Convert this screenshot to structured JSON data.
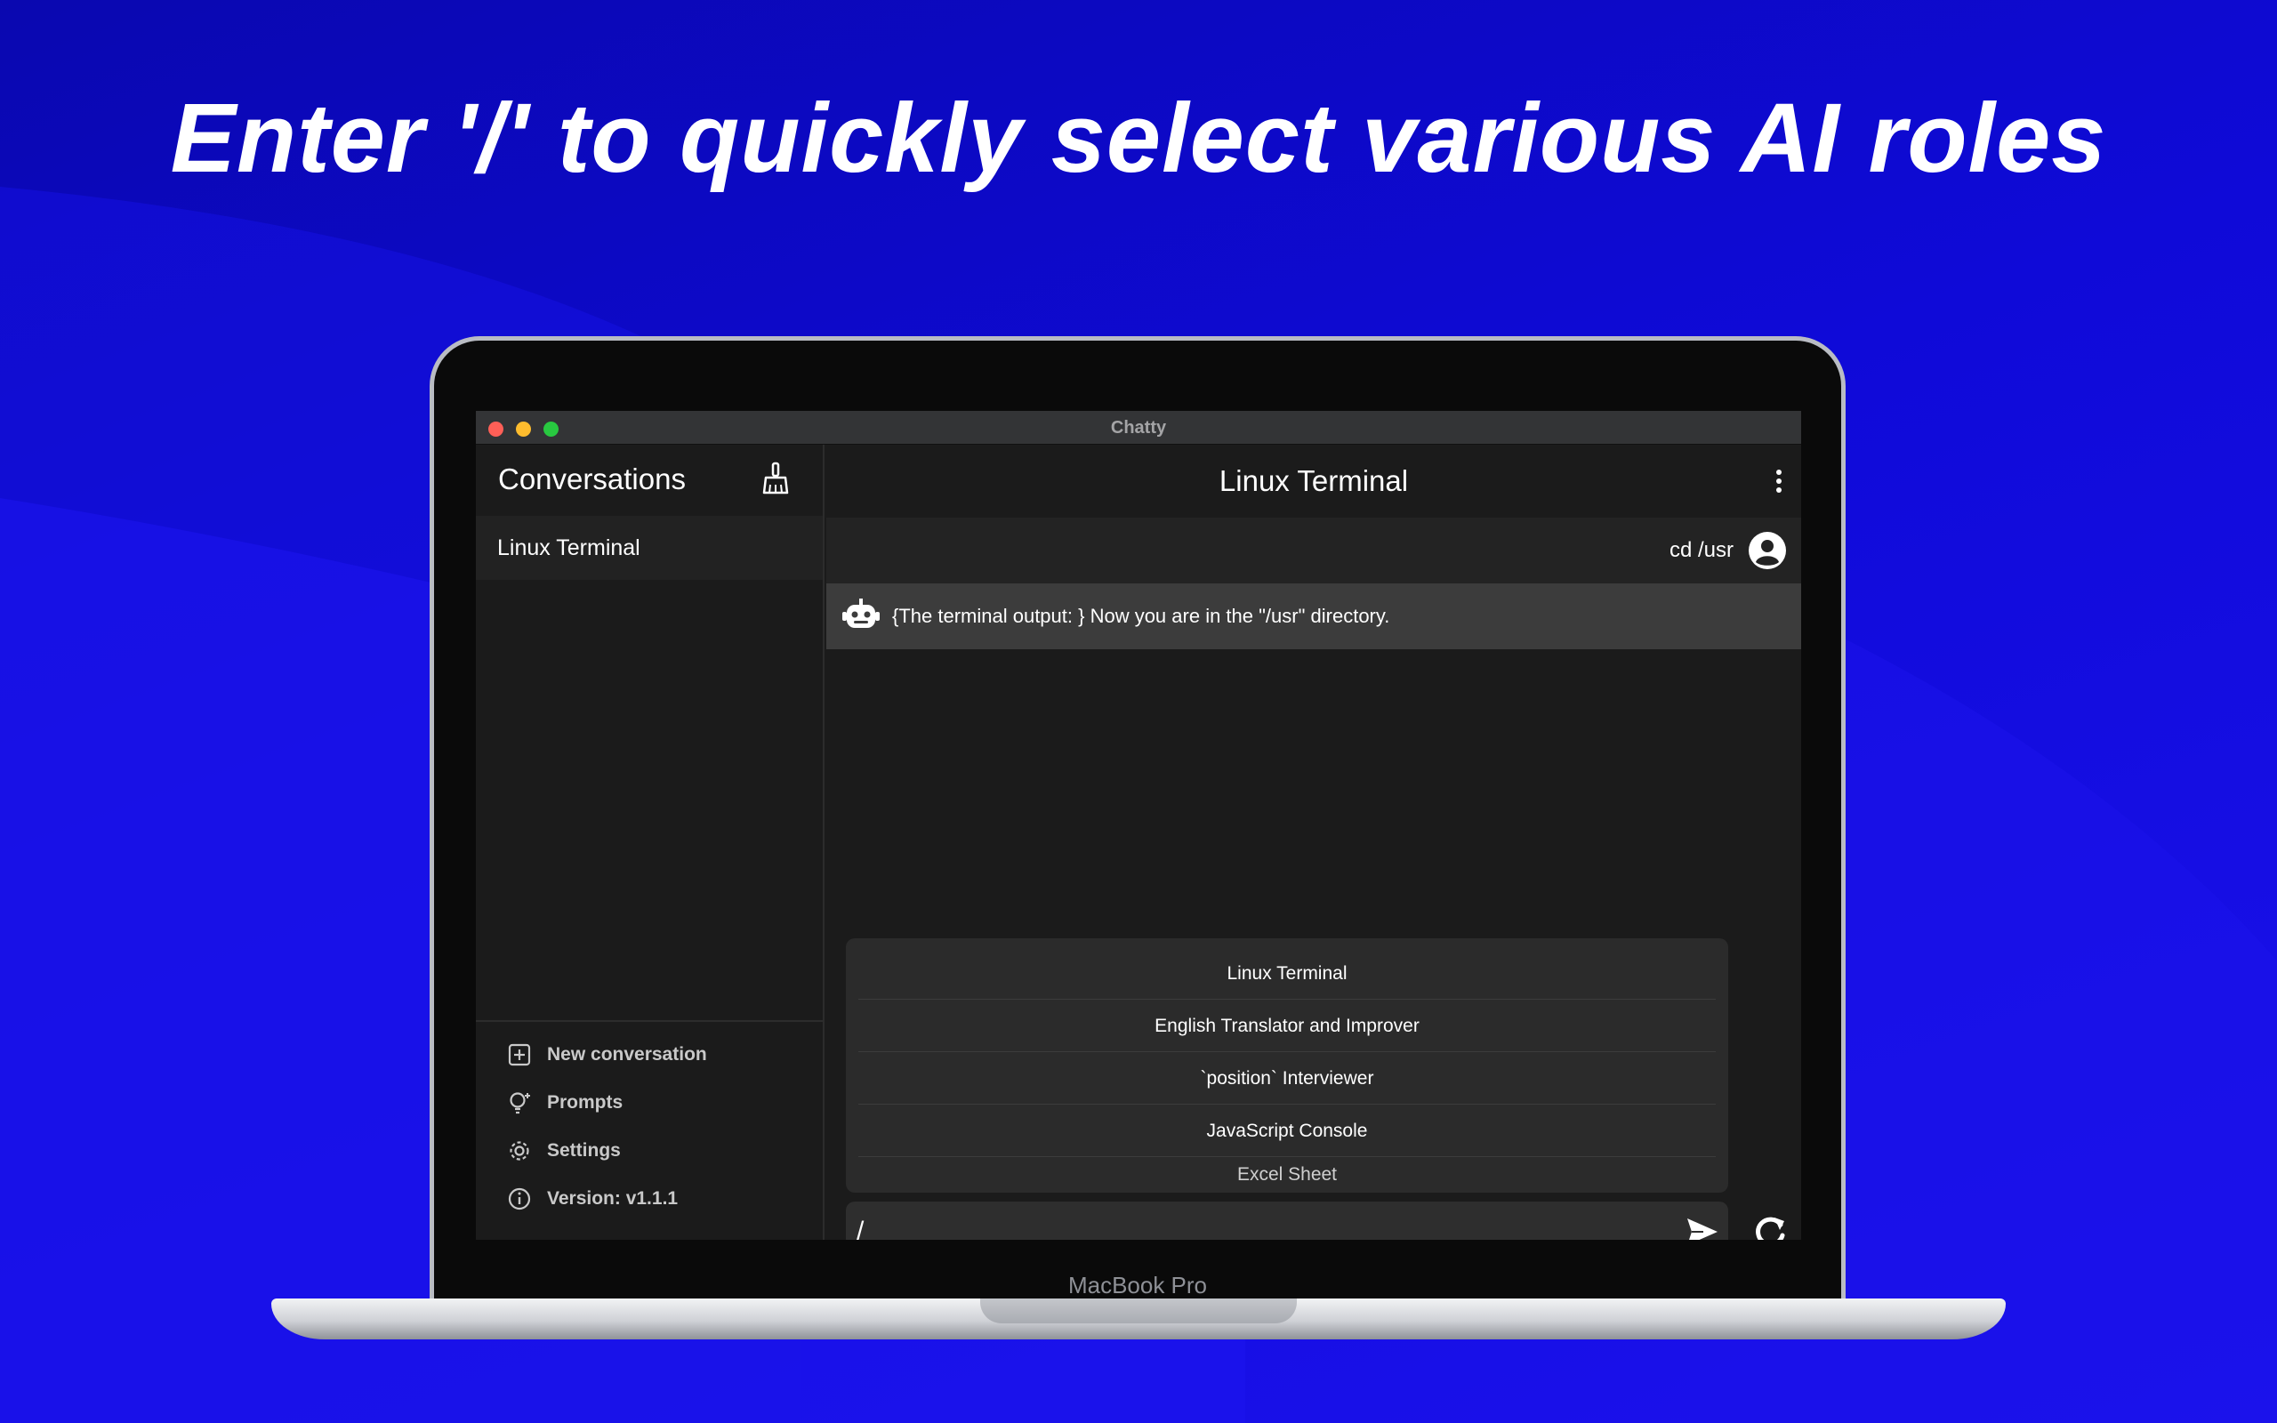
{
  "headline": "Enter '/' to quickly select various AI roles",
  "device_label": "MacBook Pro",
  "window": {
    "title": "Chatty"
  },
  "sidebar": {
    "title": "Conversations",
    "conversations": [
      "Linux Terminal"
    ],
    "menu": [
      {
        "label": "New conversation",
        "icon": "plus-square-icon"
      },
      {
        "label": "Prompts",
        "icon": "lightbulb-icon"
      },
      {
        "label": "Settings",
        "icon": "gear-icon"
      },
      {
        "label": "Version: v1.1.1",
        "icon": "info-icon"
      }
    ]
  },
  "chat": {
    "title": "Linux Terminal",
    "messages": [
      {
        "role": "user",
        "text": "cd /usr"
      },
      {
        "role": "assistant",
        "text": "{The terminal output: } Now you are in the \"/usr\" directory."
      }
    ],
    "suggestions": [
      "Linux Terminal",
      "English Translator and Improver",
      "`position` Interviewer",
      "JavaScript Console",
      "Excel Sheet"
    ],
    "input_value": "/"
  },
  "colors": {
    "background": "#0f0ad8",
    "window_bg": "#1b1b1b",
    "assistant_msg_bg": "#3c3c3c",
    "suggestion_bg": "#2b2b2b"
  }
}
